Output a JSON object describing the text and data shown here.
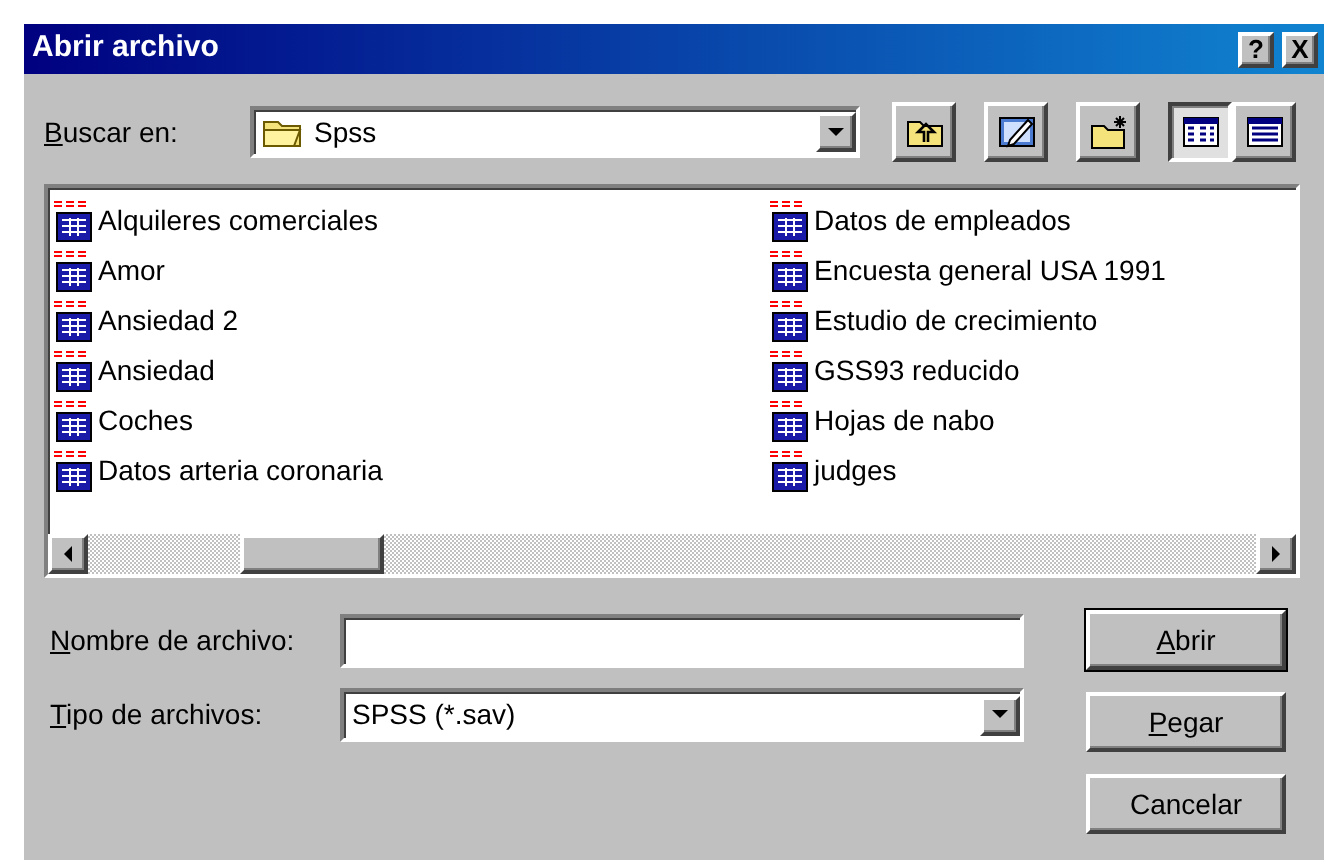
{
  "window": {
    "title": "Abrir archivo",
    "buttons": [
      {
        "label": "?"
      },
      {
        "label": "X"
      }
    ]
  },
  "look_in": {
    "label": {
      "accel": "B",
      "rest": "uscar en:"
    },
    "value": "Spss"
  },
  "toolbar": [
    {
      "kind": "up-folder",
      "selected": false
    },
    {
      "kind": "desktop",
      "selected": false
    },
    {
      "kind": "new-folder",
      "selected": false
    },
    {
      "kind": "list-view",
      "selected": true
    },
    {
      "kind": "details-view",
      "selected": false
    }
  ],
  "files": [
    "Alquileres comerciales",
    "Amor",
    "Ansiedad 2",
    "Ansiedad",
    "Coches",
    "Datos arteria coronaria",
    "Datos de empleados",
    "Encuesta general USA 1991",
    "Estudio de crecimiento",
    "GSS93 reducido",
    "Hojas de nabo",
    "judges"
  ],
  "file_name": {
    "label": {
      "accel": "N",
      "rest": "ombre de archivo:"
    }
  },
  "file_type": {
    "label": {
      "accel": "T",
      "rest": "ipo de archivos:"
    },
    "value": "SPSS (*.sav)"
  },
  "buttons": [
    {
      "label": {
        "accel": "A",
        "rest": "brir"
      },
      "default": true
    },
    {
      "label": {
        "accel": "P",
        "rest": "egar"
      },
      "default": false
    },
    {
      "label": {
        "rest": "Cancelar"
      },
      "default": false
    }
  ]
}
